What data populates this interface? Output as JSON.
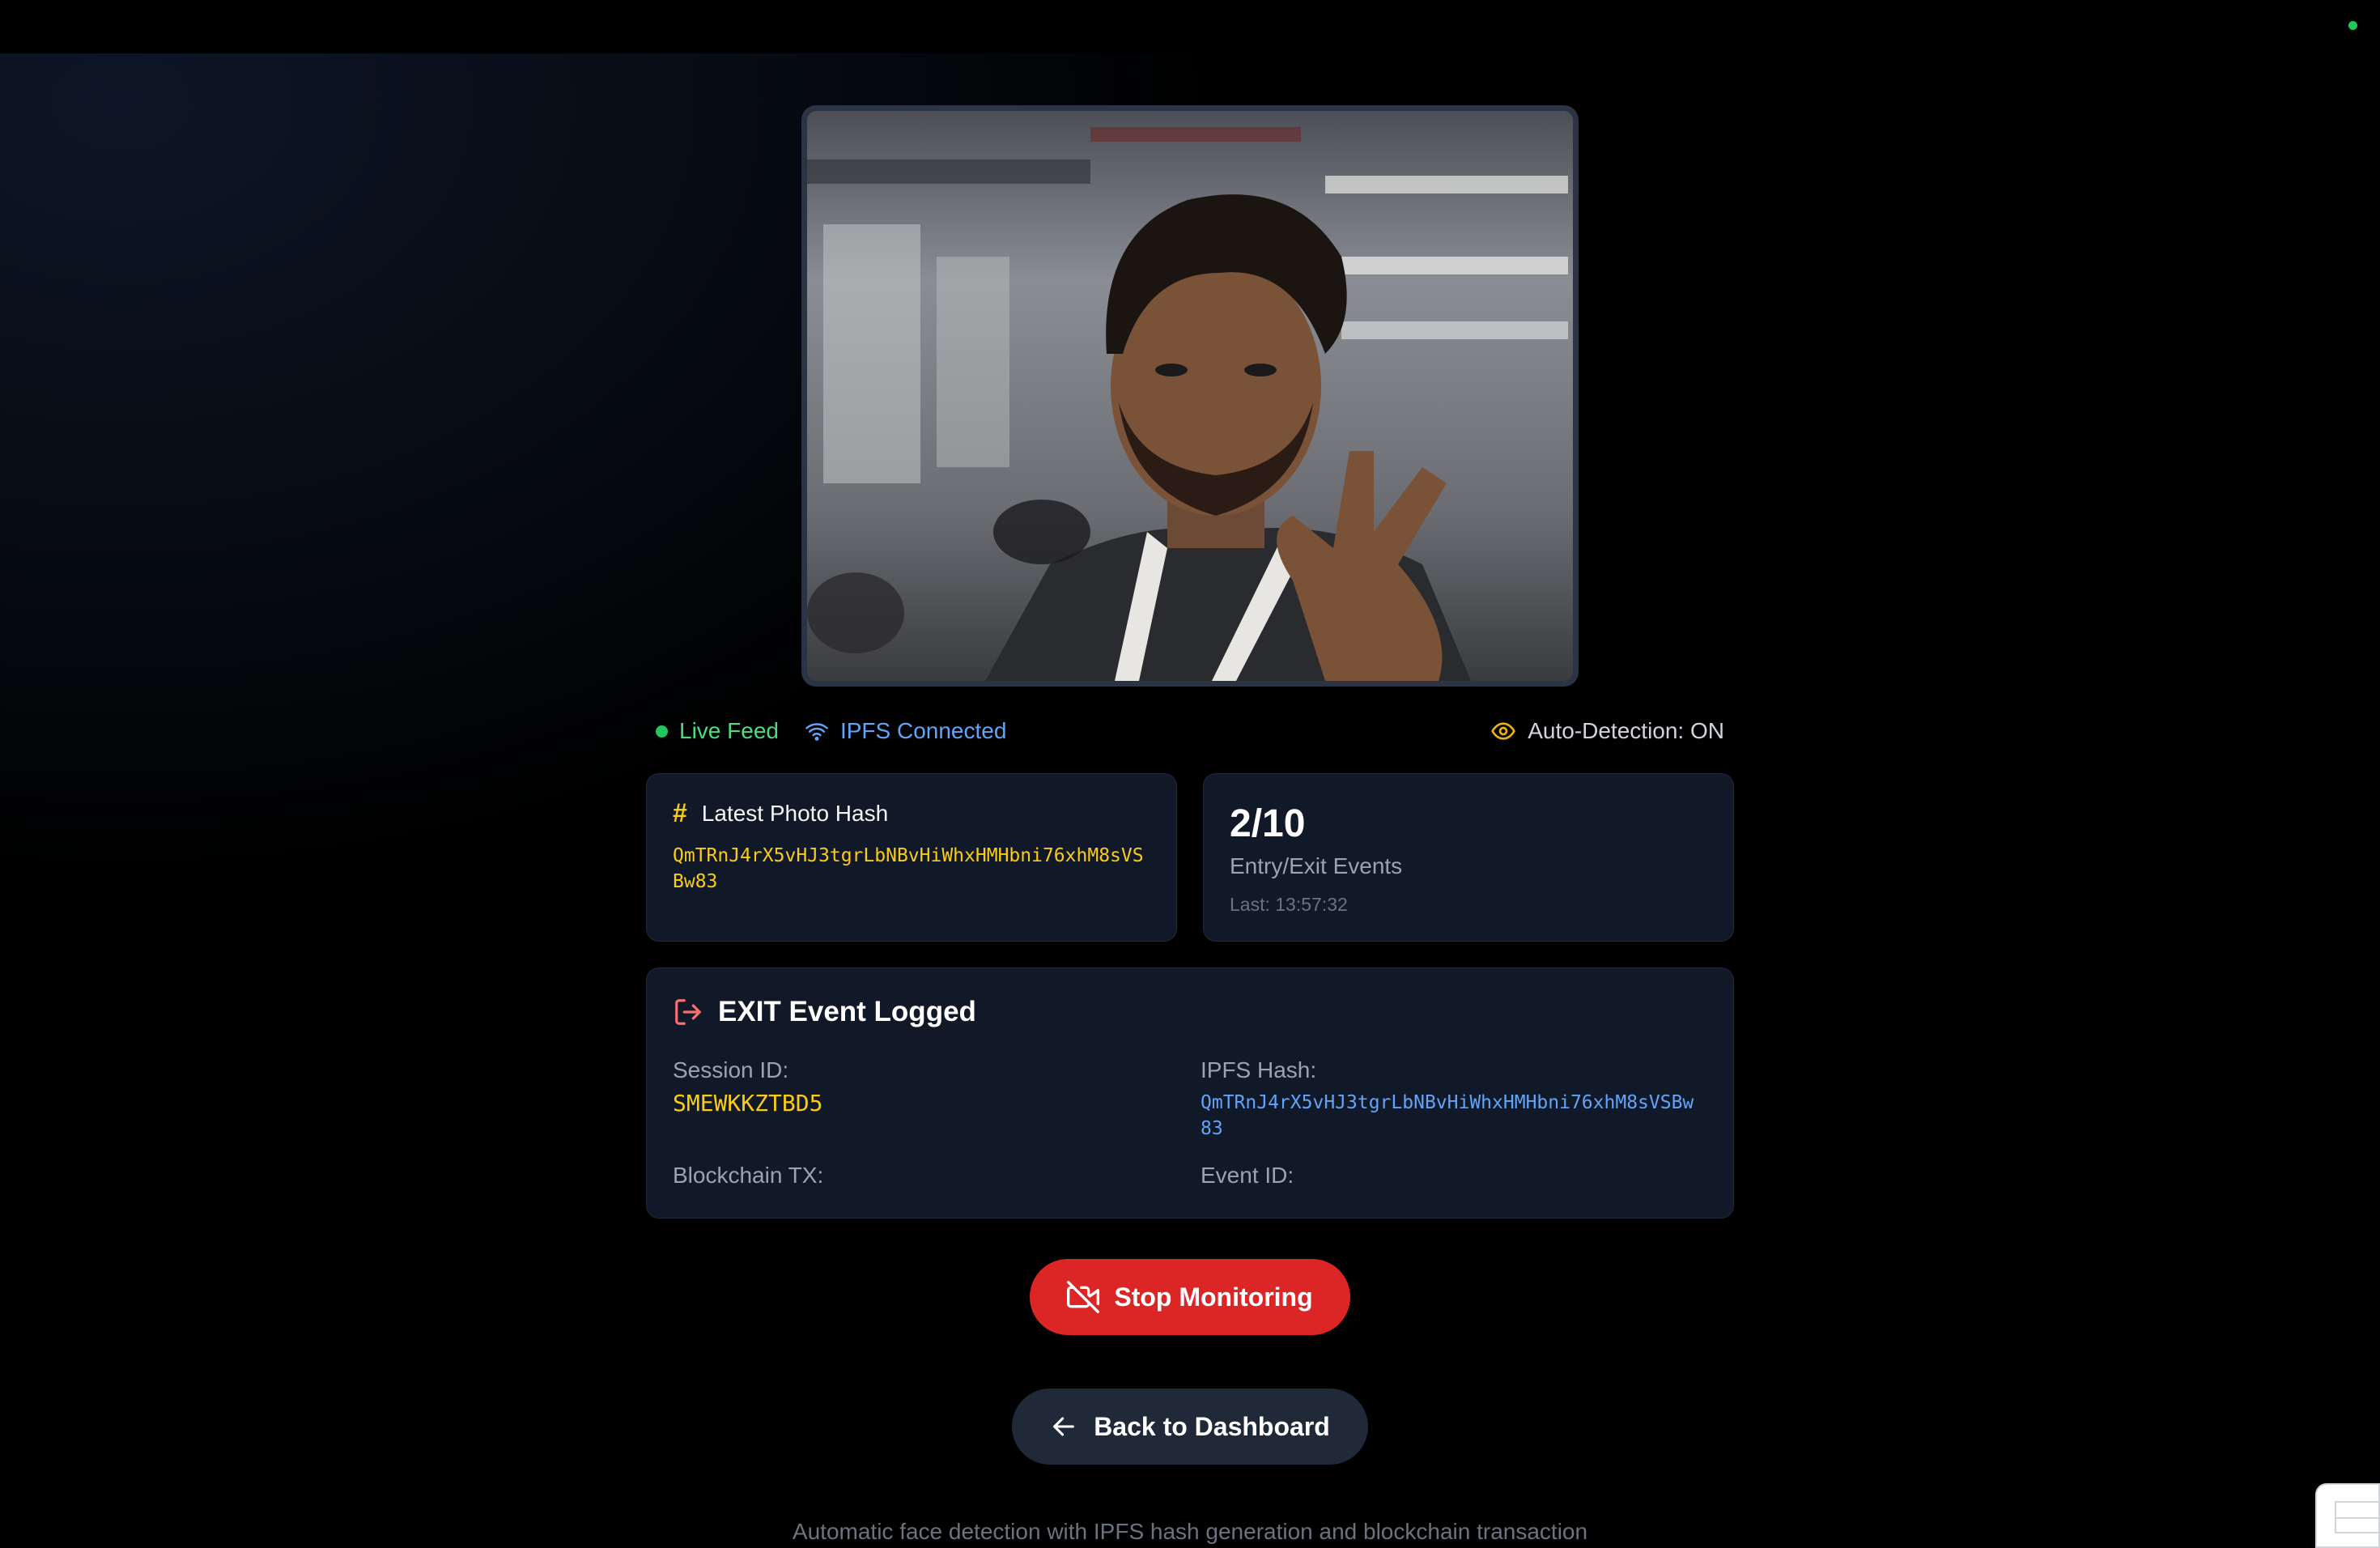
{
  "camera": {
    "status": {
      "live_label": "Live Feed",
      "ipfs_label": "IPFS Connected",
      "auto_detection_label": "Auto-Detection: ON"
    }
  },
  "hash_card": {
    "title": "Latest Photo Hash",
    "hash": "QmTRnJ4rX5vHJ3tgrLbNBvHiWhxHMHbni76xhM8sVSBw83"
  },
  "events_card": {
    "count": "2/10",
    "label": "Entry/Exit Events",
    "last": "Last: 13:57:32"
  },
  "exit_card": {
    "title": "EXIT Event Logged",
    "session_label": "Session ID:",
    "session_value": "SMEWKKZTBD5",
    "ipfs_label": "IPFS Hash:",
    "ipfs_value": "QmTRnJ4rX5vHJ3tgrLbNBvHiWhxHMHbni76xhM8sVSBw83",
    "tx_label": "Blockchain TX:",
    "event_label": "Event ID:"
  },
  "buttons": {
    "stop": "Stop Monitoring",
    "back": "Back to Dashboard"
  },
  "footer": "Automatic face detection with IPFS hash generation and blockchain transaction",
  "colors": {
    "live": "#4ade80",
    "ipfs": "#60a5fa",
    "hash": "#facc15",
    "stop_button": "#dc2626",
    "exit_icon": "#f87171"
  },
  "icons": [
    "status-dot-icon",
    "wifi-icon",
    "eye-icon",
    "hash-icon",
    "logout-icon",
    "camera-off-icon",
    "arrow-left-icon"
  ]
}
